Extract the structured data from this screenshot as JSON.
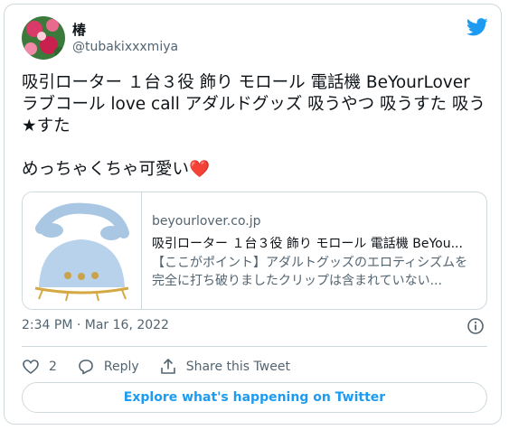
{
  "author": {
    "display_name": "椿",
    "handle": "@tubakixxxmiya"
  },
  "tweet": {
    "text": "吸引ローター １台３役 飾り モロール 電話機 BeYourLover ラブコール love call アダルドグッズ 吸うやつ 吸うすた 吸う★すた\n\nめっちゃくちゃ可愛い",
    "emoji": "❤️"
  },
  "link_card": {
    "domain": "beyourlover.co.jp",
    "title": "吸引ローター １台３役 飾り モロール 電話機 BeYou...",
    "description": "【ここがポイント】アダルトグッズのエロティシズムを完全に打ち破りましたクリップは含まれていない..."
  },
  "meta": {
    "timestamp": "2:34 PM · Mar 16, 2022"
  },
  "actions": {
    "like_count": "2",
    "reply_label": "Reply",
    "share_label": "Share this Tweet"
  },
  "footer": {
    "explore_label": "Explore what's happening on Twitter"
  },
  "colors": {
    "accent": "#1d9bf0",
    "secondary_text": "#536471",
    "border": "#cfd9de",
    "heart": "#e0245e"
  }
}
